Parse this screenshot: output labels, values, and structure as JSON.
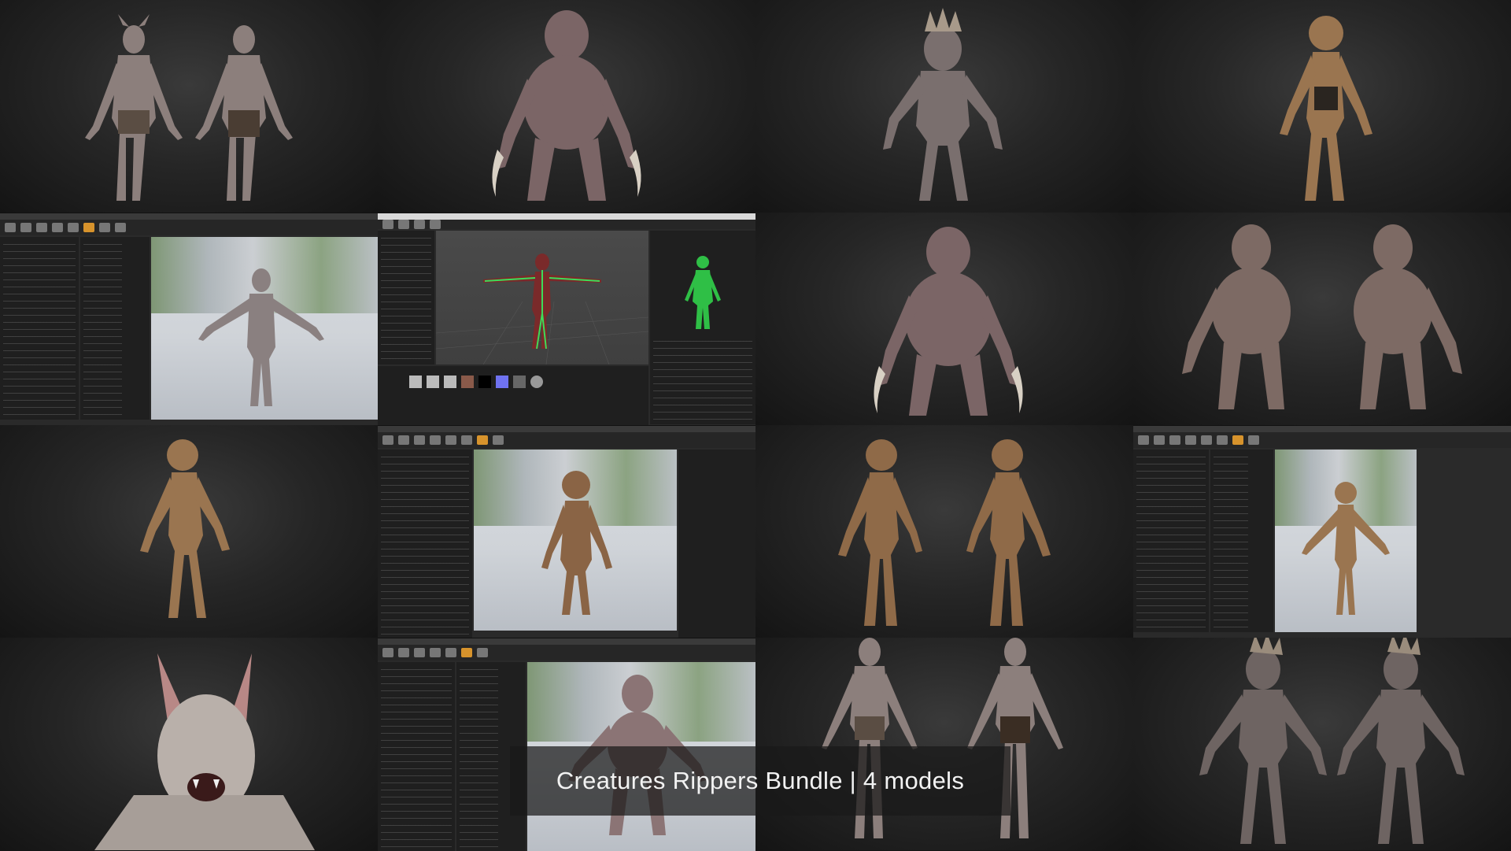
{
  "caption": {
    "title": "Creatures Rippers Bundle | 4 models"
  },
  "colors": {
    "background": "#151515",
    "caption_background": "#191919",
    "caption_text": "#f2f2f2",
    "editor_accent": "#d7932c"
  },
  "tiles": [
    {
      "name": "bat-creature-front-back",
      "kind": "render"
    },
    {
      "name": "brute-creature-front",
      "kind": "render"
    },
    {
      "name": "spiked-creature-front",
      "kind": "render"
    },
    {
      "name": "goblin-creature-front",
      "kind": "render"
    },
    {
      "name": "unreal-retarget-bat-screenshot",
      "kind": "editor"
    },
    {
      "name": "unity-rig-spiked-screenshot",
      "kind": "editor"
    },
    {
      "name": "brute-creature-front-2",
      "kind": "render"
    },
    {
      "name": "brute-creature-wireframe",
      "kind": "render"
    },
    {
      "name": "goblin-creature-side",
      "kind": "render"
    },
    {
      "name": "unreal-material-goblin-screenshot",
      "kind": "editor"
    },
    {
      "name": "goblin-creature-wireframe",
      "kind": "render"
    },
    {
      "name": "unreal-retarget-goblin-screenshot",
      "kind": "editor"
    },
    {
      "name": "bat-creature-closeup",
      "kind": "render"
    },
    {
      "name": "unreal-retarget-brute-screenshot",
      "kind": "editor"
    },
    {
      "name": "bat-creature-wireframe",
      "kind": "render"
    },
    {
      "name": "spiked-creature-wireframe",
      "kind": "render"
    }
  ]
}
